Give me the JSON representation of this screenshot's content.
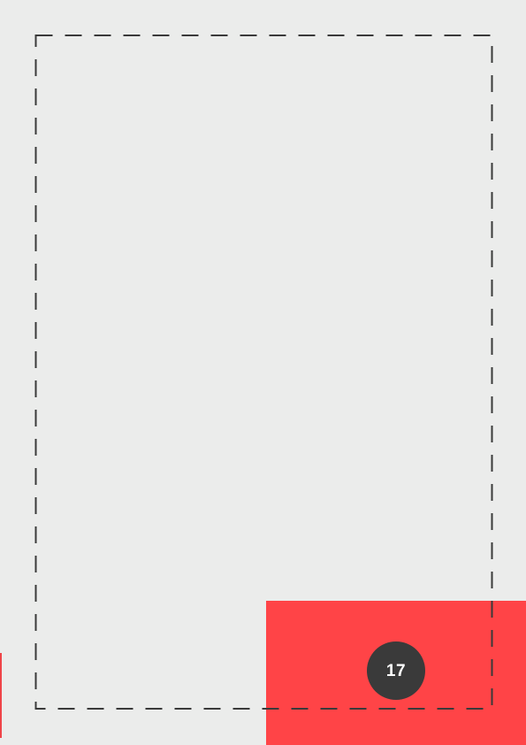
{
  "page": {
    "background_color": "#ebeceb",
    "accent_color": "#ff4447",
    "frame_color": "#3a3a3a",
    "badge_color": "#3a3a3a"
  },
  "footer": {
    "page_number": "17"
  }
}
